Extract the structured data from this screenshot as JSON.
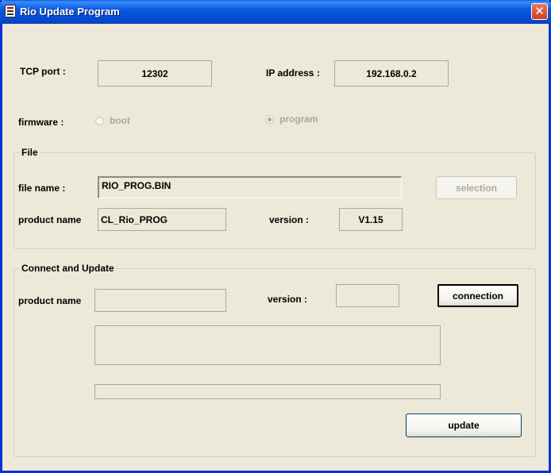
{
  "window": {
    "title": "Rio Update Program",
    "close_symbol": "✕"
  },
  "tcp": {
    "label": "TCP port :",
    "value": "12302"
  },
  "ip": {
    "label": "IP address :",
    "value": "192.168.0.2"
  },
  "firmware": {
    "label": "firmware :",
    "options": [
      {
        "label": "boot",
        "selected": false,
        "enabled": false
      },
      {
        "label": "program",
        "selected": true,
        "enabled": false
      }
    ]
  },
  "file": {
    "title": "File",
    "file_name_label": "file name :",
    "file_name_value": "RIO_PROG.BIN",
    "selection_label": "selection",
    "product_name_label": "product name",
    "product_name_value": "CL_Rio_PROG",
    "version_label": "version :",
    "version_value": "V1.15"
  },
  "connect": {
    "title": "Connect and Update",
    "product_name_label": "product name",
    "product_name_value": "",
    "version_label": "version :",
    "version_value": "",
    "connection_label": "connection",
    "update_label": "update",
    "log_text": "",
    "progress": 0
  }
}
